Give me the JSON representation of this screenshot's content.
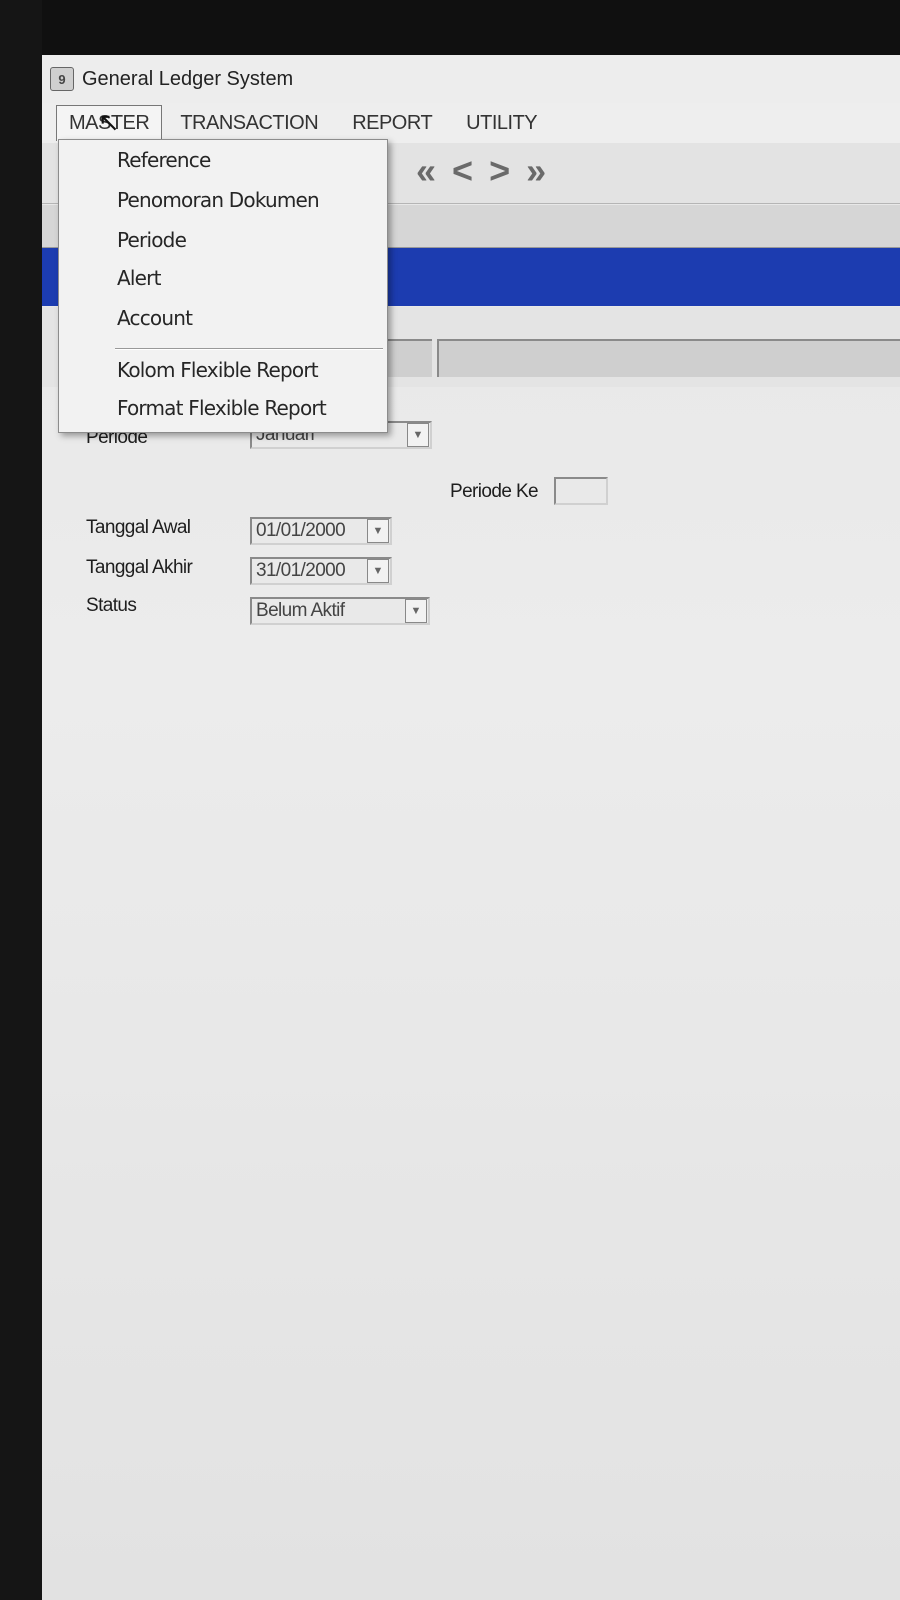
{
  "window": {
    "title": "General Ledger System",
    "app_icon": "9"
  },
  "menubar": {
    "items": [
      "MASTER",
      "TRANSACTION",
      "REPORT",
      "UTILITY"
    ]
  },
  "toolbar": {
    "nav": {
      "first": "«",
      "prev": "<",
      "next": ">",
      "last": "»"
    }
  },
  "master_menu": {
    "items": [
      "Reference",
      "Penomoran Dokumen",
      "Periode",
      "Alert",
      "Account",
      "Kolom Flexible Report",
      "Format Flexible Report"
    ]
  },
  "form": {
    "periode": {
      "label": "Periode",
      "value": "Januari"
    },
    "periode_ke": {
      "label": "Periode Ke",
      "value": ""
    },
    "tanggal_awal": {
      "label": "Tanggal Awal",
      "value": "01/01/2000"
    },
    "tanggal_akhir": {
      "label": "Tanggal Akhir",
      "value": "31/01/2000"
    },
    "status": {
      "label": "Status",
      "value": "Belum Aktif"
    }
  },
  "colors": {
    "header_bar": "#1c3cb0",
    "window_bg": "#e6e6e6"
  }
}
